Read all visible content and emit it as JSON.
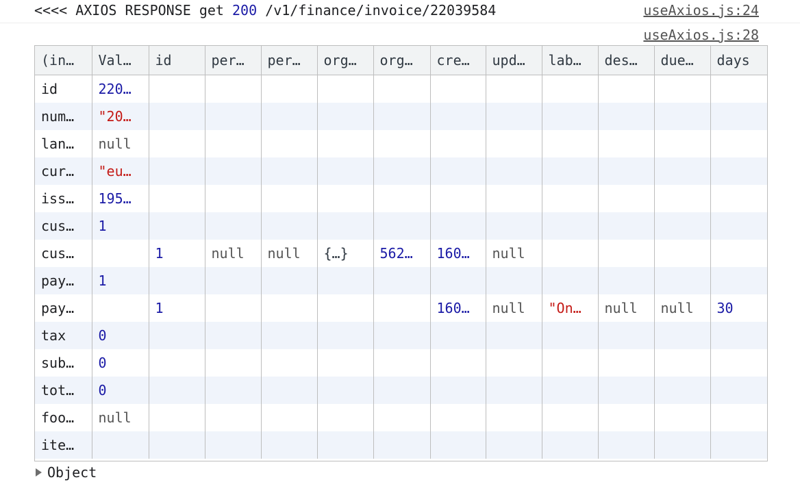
{
  "log": {
    "prefix": "<<<< AXIOS RESPONSE get ",
    "status": "200",
    "path": " /v1/finance/invoice/22039584",
    "source1": "useAxios.js:24",
    "source2": "useAxios.js:28"
  },
  "table": {
    "columns": [
      "(in…",
      "Val…",
      "id",
      "per…",
      "per…",
      "org…",
      "org…",
      "cre…",
      "upd…",
      "lab…",
      "des…",
      "due…",
      "days"
    ],
    "rows": [
      [
        {
          "t": "id",
          "k": "key"
        },
        {
          "t": "220…",
          "k": "num"
        },
        {
          "t": "",
          "k": ""
        },
        {
          "t": "",
          "k": ""
        },
        {
          "t": "",
          "k": ""
        },
        {
          "t": "",
          "k": ""
        },
        {
          "t": "",
          "k": ""
        },
        {
          "t": "",
          "k": ""
        },
        {
          "t": "",
          "k": ""
        },
        {
          "t": "",
          "k": ""
        },
        {
          "t": "",
          "k": ""
        },
        {
          "t": "",
          "k": ""
        },
        {
          "t": "",
          "k": ""
        }
      ],
      [
        {
          "t": "num…",
          "k": "key"
        },
        {
          "t": "\"20…",
          "k": "str"
        },
        {
          "t": "",
          "k": ""
        },
        {
          "t": "",
          "k": ""
        },
        {
          "t": "",
          "k": ""
        },
        {
          "t": "",
          "k": ""
        },
        {
          "t": "",
          "k": ""
        },
        {
          "t": "",
          "k": ""
        },
        {
          "t": "",
          "k": ""
        },
        {
          "t": "",
          "k": ""
        },
        {
          "t": "",
          "k": ""
        },
        {
          "t": "",
          "k": ""
        },
        {
          "t": "",
          "k": ""
        }
      ],
      [
        {
          "t": "lan…",
          "k": "key"
        },
        {
          "t": "null",
          "k": "null"
        },
        {
          "t": "",
          "k": ""
        },
        {
          "t": "",
          "k": ""
        },
        {
          "t": "",
          "k": ""
        },
        {
          "t": "",
          "k": ""
        },
        {
          "t": "",
          "k": ""
        },
        {
          "t": "",
          "k": ""
        },
        {
          "t": "",
          "k": ""
        },
        {
          "t": "",
          "k": ""
        },
        {
          "t": "",
          "k": ""
        },
        {
          "t": "",
          "k": ""
        },
        {
          "t": "",
          "k": ""
        }
      ],
      [
        {
          "t": "cur…",
          "k": "key"
        },
        {
          "t": "\"eu…",
          "k": "str"
        },
        {
          "t": "",
          "k": ""
        },
        {
          "t": "",
          "k": ""
        },
        {
          "t": "",
          "k": ""
        },
        {
          "t": "",
          "k": ""
        },
        {
          "t": "",
          "k": ""
        },
        {
          "t": "",
          "k": ""
        },
        {
          "t": "",
          "k": ""
        },
        {
          "t": "",
          "k": ""
        },
        {
          "t": "",
          "k": ""
        },
        {
          "t": "",
          "k": ""
        },
        {
          "t": "",
          "k": ""
        }
      ],
      [
        {
          "t": "iss…",
          "k": "key"
        },
        {
          "t": "195…",
          "k": "num"
        },
        {
          "t": "",
          "k": ""
        },
        {
          "t": "",
          "k": ""
        },
        {
          "t": "",
          "k": ""
        },
        {
          "t": "",
          "k": ""
        },
        {
          "t": "",
          "k": ""
        },
        {
          "t": "",
          "k": ""
        },
        {
          "t": "",
          "k": ""
        },
        {
          "t": "",
          "k": ""
        },
        {
          "t": "",
          "k": ""
        },
        {
          "t": "",
          "k": ""
        },
        {
          "t": "",
          "k": ""
        }
      ],
      [
        {
          "t": "cus…",
          "k": "key"
        },
        {
          "t": "1",
          "k": "num"
        },
        {
          "t": "",
          "k": ""
        },
        {
          "t": "",
          "k": ""
        },
        {
          "t": "",
          "k": ""
        },
        {
          "t": "",
          "k": ""
        },
        {
          "t": "",
          "k": ""
        },
        {
          "t": "",
          "k": ""
        },
        {
          "t": "",
          "k": ""
        },
        {
          "t": "",
          "k": ""
        },
        {
          "t": "",
          "k": ""
        },
        {
          "t": "",
          "k": ""
        },
        {
          "t": "",
          "k": ""
        }
      ],
      [
        {
          "t": "cus…",
          "k": "key"
        },
        {
          "t": "",
          "k": ""
        },
        {
          "t": "1",
          "k": "num"
        },
        {
          "t": "null",
          "k": "null"
        },
        {
          "t": "null",
          "k": "null"
        },
        {
          "t": "{…}",
          "k": "obj"
        },
        {
          "t": "562…",
          "k": "num"
        },
        {
          "t": "160…",
          "k": "num"
        },
        {
          "t": "null",
          "k": "null"
        },
        {
          "t": "",
          "k": ""
        },
        {
          "t": "",
          "k": ""
        },
        {
          "t": "",
          "k": ""
        },
        {
          "t": "",
          "k": ""
        }
      ],
      [
        {
          "t": "pay…",
          "k": "key"
        },
        {
          "t": "1",
          "k": "num"
        },
        {
          "t": "",
          "k": ""
        },
        {
          "t": "",
          "k": ""
        },
        {
          "t": "",
          "k": ""
        },
        {
          "t": "",
          "k": ""
        },
        {
          "t": "",
          "k": ""
        },
        {
          "t": "",
          "k": ""
        },
        {
          "t": "",
          "k": ""
        },
        {
          "t": "",
          "k": ""
        },
        {
          "t": "",
          "k": ""
        },
        {
          "t": "",
          "k": ""
        },
        {
          "t": "",
          "k": ""
        }
      ],
      [
        {
          "t": "pay…",
          "k": "key"
        },
        {
          "t": "",
          "k": ""
        },
        {
          "t": "1",
          "k": "num"
        },
        {
          "t": "",
          "k": ""
        },
        {
          "t": "",
          "k": ""
        },
        {
          "t": "",
          "k": ""
        },
        {
          "t": "",
          "k": ""
        },
        {
          "t": "160…",
          "k": "num"
        },
        {
          "t": "null",
          "k": "null"
        },
        {
          "t": "\"On…",
          "k": "str"
        },
        {
          "t": "null",
          "k": "null"
        },
        {
          "t": "null",
          "k": "null"
        },
        {
          "t": "30",
          "k": "num"
        }
      ],
      [
        {
          "t": "tax",
          "k": "key"
        },
        {
          "t": "0",
          "k": "num"
        },
        {
          "t": "",
          "k": ""
        },
        {
          "t": "",
          "k": ""
        },
        {
          "t": "",
          "k": ""
        },
        {
          "t": "",
          "k": ""
        },
        {
          "t": "",
          "k": ""
        },
        {
          "t": "",
          "k": ""
        },
        {
          "t": "",
          "k": ""
        },
        {
          "t": "",
          "k": ""
        },
        {
          "t": "",
          "k": ""
        },
        {
          "t": "",
          "k": ""
        },
        {
          "t": "",
          "k": ""
        }
      ],
      [
        {
          "t": "sub…",
          "k": "key"
        },
        {
          "t": "0",
          "k": "num"
        },
        {
          "t": "",
          "k": ""
        },
        {
          "t": "",
          "k": ""
        },
        {
          "t": "",
          "k": ""
        },
        {
          "t": "",
          "k": ""
        },
        {
          "t": "",
          "k": ""
        },
        {
          "t": "",
          "k": ""
        },
        {
          "t": "",
          "k": ""
        },
        {
          "t": "",
          "k": ""
        },
        {
          "t": "",
          "k": ""
        },
        {
          "t": "",
          "k": ""
        },
        {
          "t": "",
          "k": ""
        }
      ],
      [
        {
          "t": "tot…",
          "k": "key"
        },
        {
          "t": "0",
          "k": "num"
        },
        {
          "t": "",
          "k": ""
        },
        {
          "t": "",
          "k": ""
        },
        {
          "t": "",
          "k": ""
        },
        {
          "t": "",
          "k": ""
        },
        {
          "t": "",
          "k": ""
        },
        {
          "t": "",
          "k": ""
        },
        {
          "t": "",
          "k": ""
        },
        {
          "t": "",
          "k": ""
        },
        {
          "t": "",
          "k": ""
        },
        {
          "t": "",
          "k": ""
        },
        {
          "t": "",
          "k": ""
        }
      ],
      [
        {
          "t": "foo…",
          "k": "key"
        },
        {
          "t": "null",
          "k": "null"
        },
        {
          "t": "",
          "k": ""
        },
        {
          "t": "",
          "k": ""
        },
        {
          "t": "",
          "k": ""
        },
        {
          "t": "",
          "k": ""
        },
        {
          "t": "",
          "k": ""
        },
        {
          "t": "",
          "k": ""
        },
        {
          "t": "",
          "k": ""
        },
        {
          "t": "",
          "k": ""
        },
        {
          "t": "",
          "k": ""
        },
        {
          "t": "",
          "k": ""
        },
        {
          "t": "",
          "k": ""
        }
      ],
      [
        {
          "t": "ite…",
          "k": "key"
        },
        {
          "t": "",
          "k": ""
        },
        {
          "t": "",
          "k": ""
        },
        {
          "t": "",
          "k": ""
        },
        {
          "t": "",
          "k": ""
        },
        {
          "t": "",
          "k": ""
        },
        {
          "t": "",
          "k": ""
        },
        {
          "t": "",
          "k": ""
        },
        {
          "t": "",
          "k": ""
        },
        {
          "t": "",
          "k": ""
        },
        {
          "t": "",
          "k": ""
        },
        {
          "t": "",
          "k": ""
        },
        {
          "t": "",
          "k": ""
        }
      ]
    ]
  },
  "object_toggle": {
    "icon": "expand-triangle-icon",
    "label": "Object"
  },
  "colors": {
    "number": "#1a1aa6",
    "string": "#c41a16",
    "null": "#545454",
    "header_bg": "#f1f3f4",
    "stripe": "#f0f4fb",
    "border": "#bdbdbd"
  }
}
